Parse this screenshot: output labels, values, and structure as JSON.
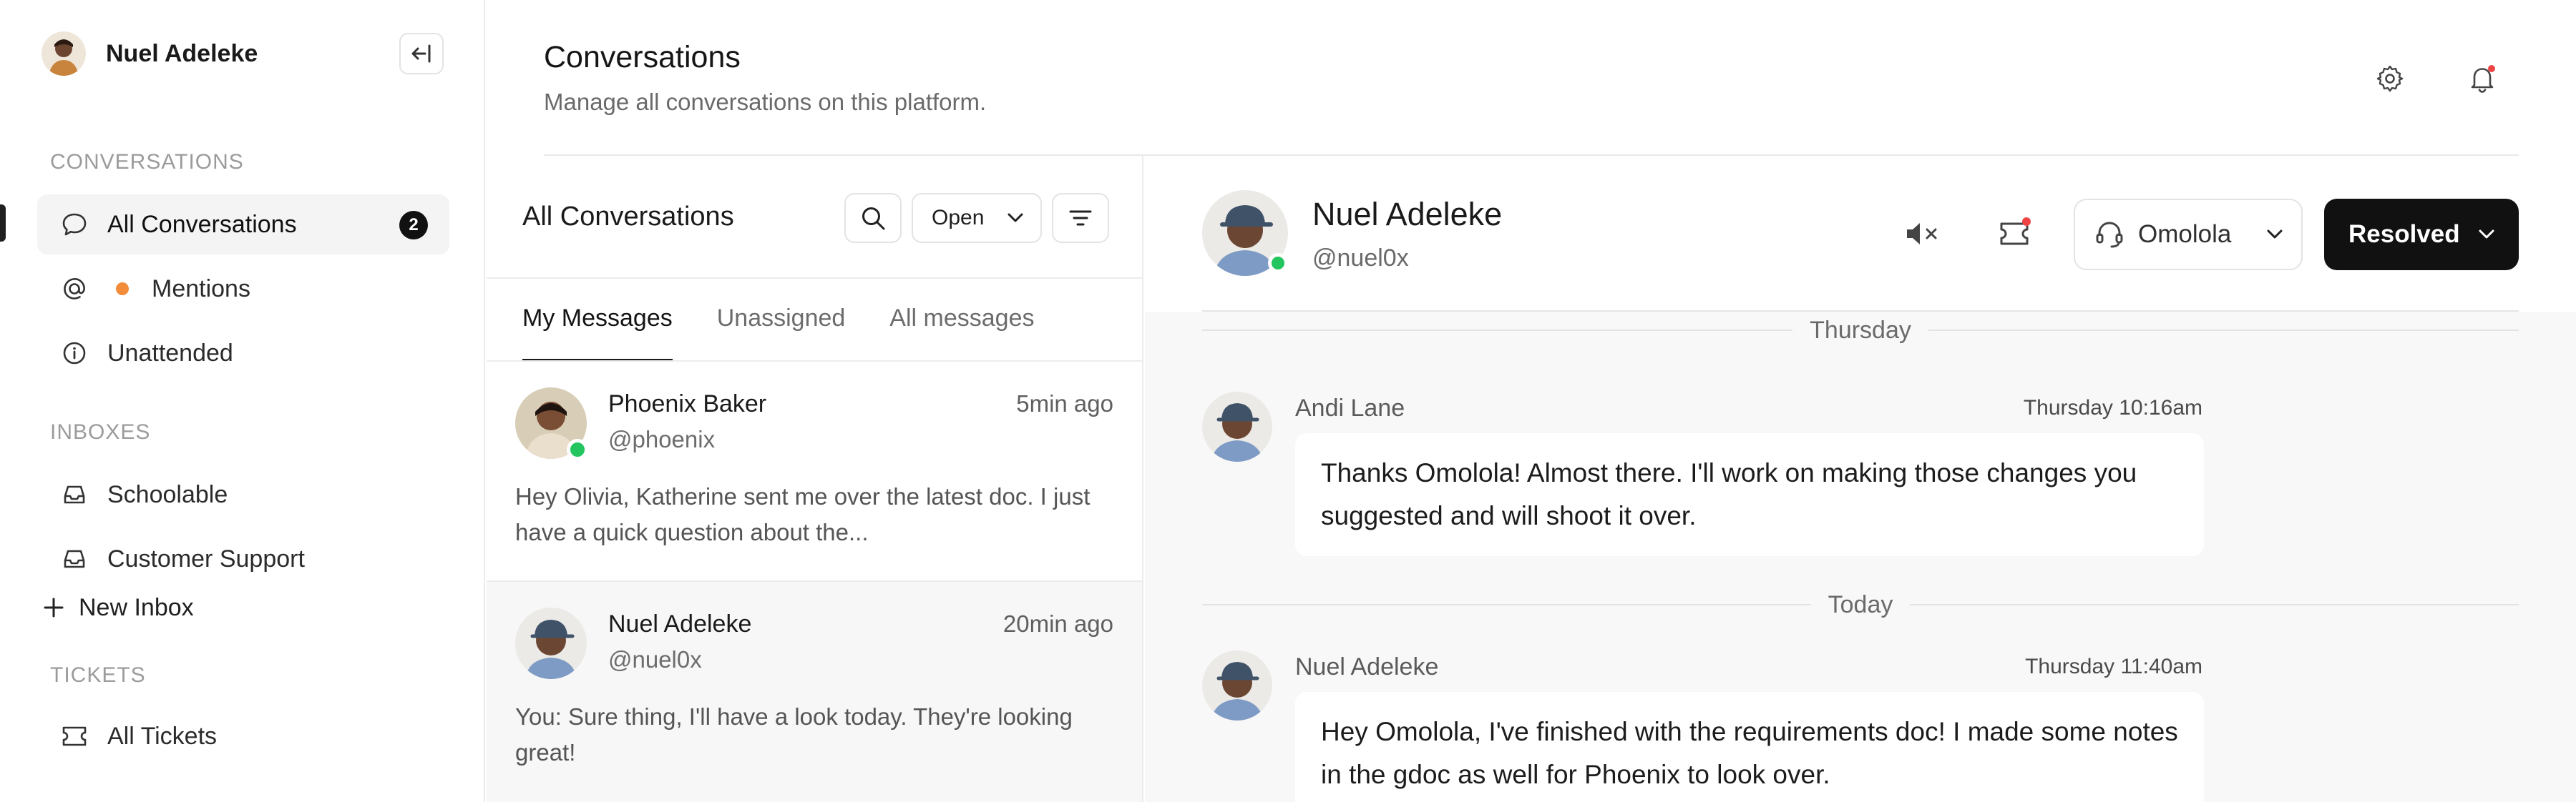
{
  "sidebar": {
    "user_name": "Nuel Adeleke",
    "sections": {
      "conversations": "CONVERSATIONS",
      "inboxes": "INBOXES",
      "tickets": "TICKETS"
    },
    "conversation_items": [
      {
        "label": "All Conversations",
        "icon": "chat-bubble-icon",
        "badge": "2",
        "active": true
      },
      {
        "label": "Mentions",
        "icon": "at-sign-icon",
        "status_color": "#f28c38"
      },
      {
        "label": "Unattended",
        "icon": "info-icon"
      }
    ],
    "inbox_items": [
      {
        "label": "Schoolable",
        "icon": "inbox-tray-icon"
      },
      {
        "label": "Customer Support",
        "icon": "inbox-tray-icon"
      }
    ],
    "new_inbox_label": "New Inbox",
    "ticket_items": [
      {
        "label": "All Tickets",
        "icon": "ticket-icon"
      }
    ]
  },
  "header": {
    "title": "Conversations",
    "subtitle": "Manage all conversations on this platform."
  },
  "list": {
    "title": "All Conversations",
    "status_filter": "Open",
    "tabs": [
      "My Messages",
      "Unassigned",
      "All messages"
    ],
    "active_tab": 0,
    "conversations": [
      {
        "name": "Phoenix Baker",
        "handle": "@phoenix",
        "time": "5min ago",
        "preview": "Hey Olivia, Katherine sent me over the latest doc. I just have a quick question about the...",
        "online": true
      },
      {
        "name": "Nuel Adeleke",
        "handle": "@nuel0x",
        "time": "20min ago",
        "preview": "You: Sure thing, I'll have a look today. They're looking great!",
        "selected": true
      }
    ]
  },
  "chat": {
    "name": "Nuel Adeleke",
    "handle": "@nuel0x",
    "assignee": "Omolola",
    "status_button": "Resolved",
    "online": true,
    "days": [
      "Thursday",
      "Today"
    ],
    "messages": [
      {
        "sender": "Andi Lane",
        "time": "Thursday 10:16am",
        "text": "Thanks Omolola! Almost there. I'll work on making those changes you suggested and will shoot it over."
      },
      {
        "sender": "Nuel Adeleke",
        "time": "Thursday 11:40am",
        "text": "Hey Omolola, I've finished with the requirements doc! I made some notes in the gdoc as well for Phoenix to look over."
      }
    ]
  },
  "colors": {
    "accent": "#111111",
    "online": "#22c55e",
    "notification": "#ef4444",
    "mention_dot": "#f28c38"
  }
}
